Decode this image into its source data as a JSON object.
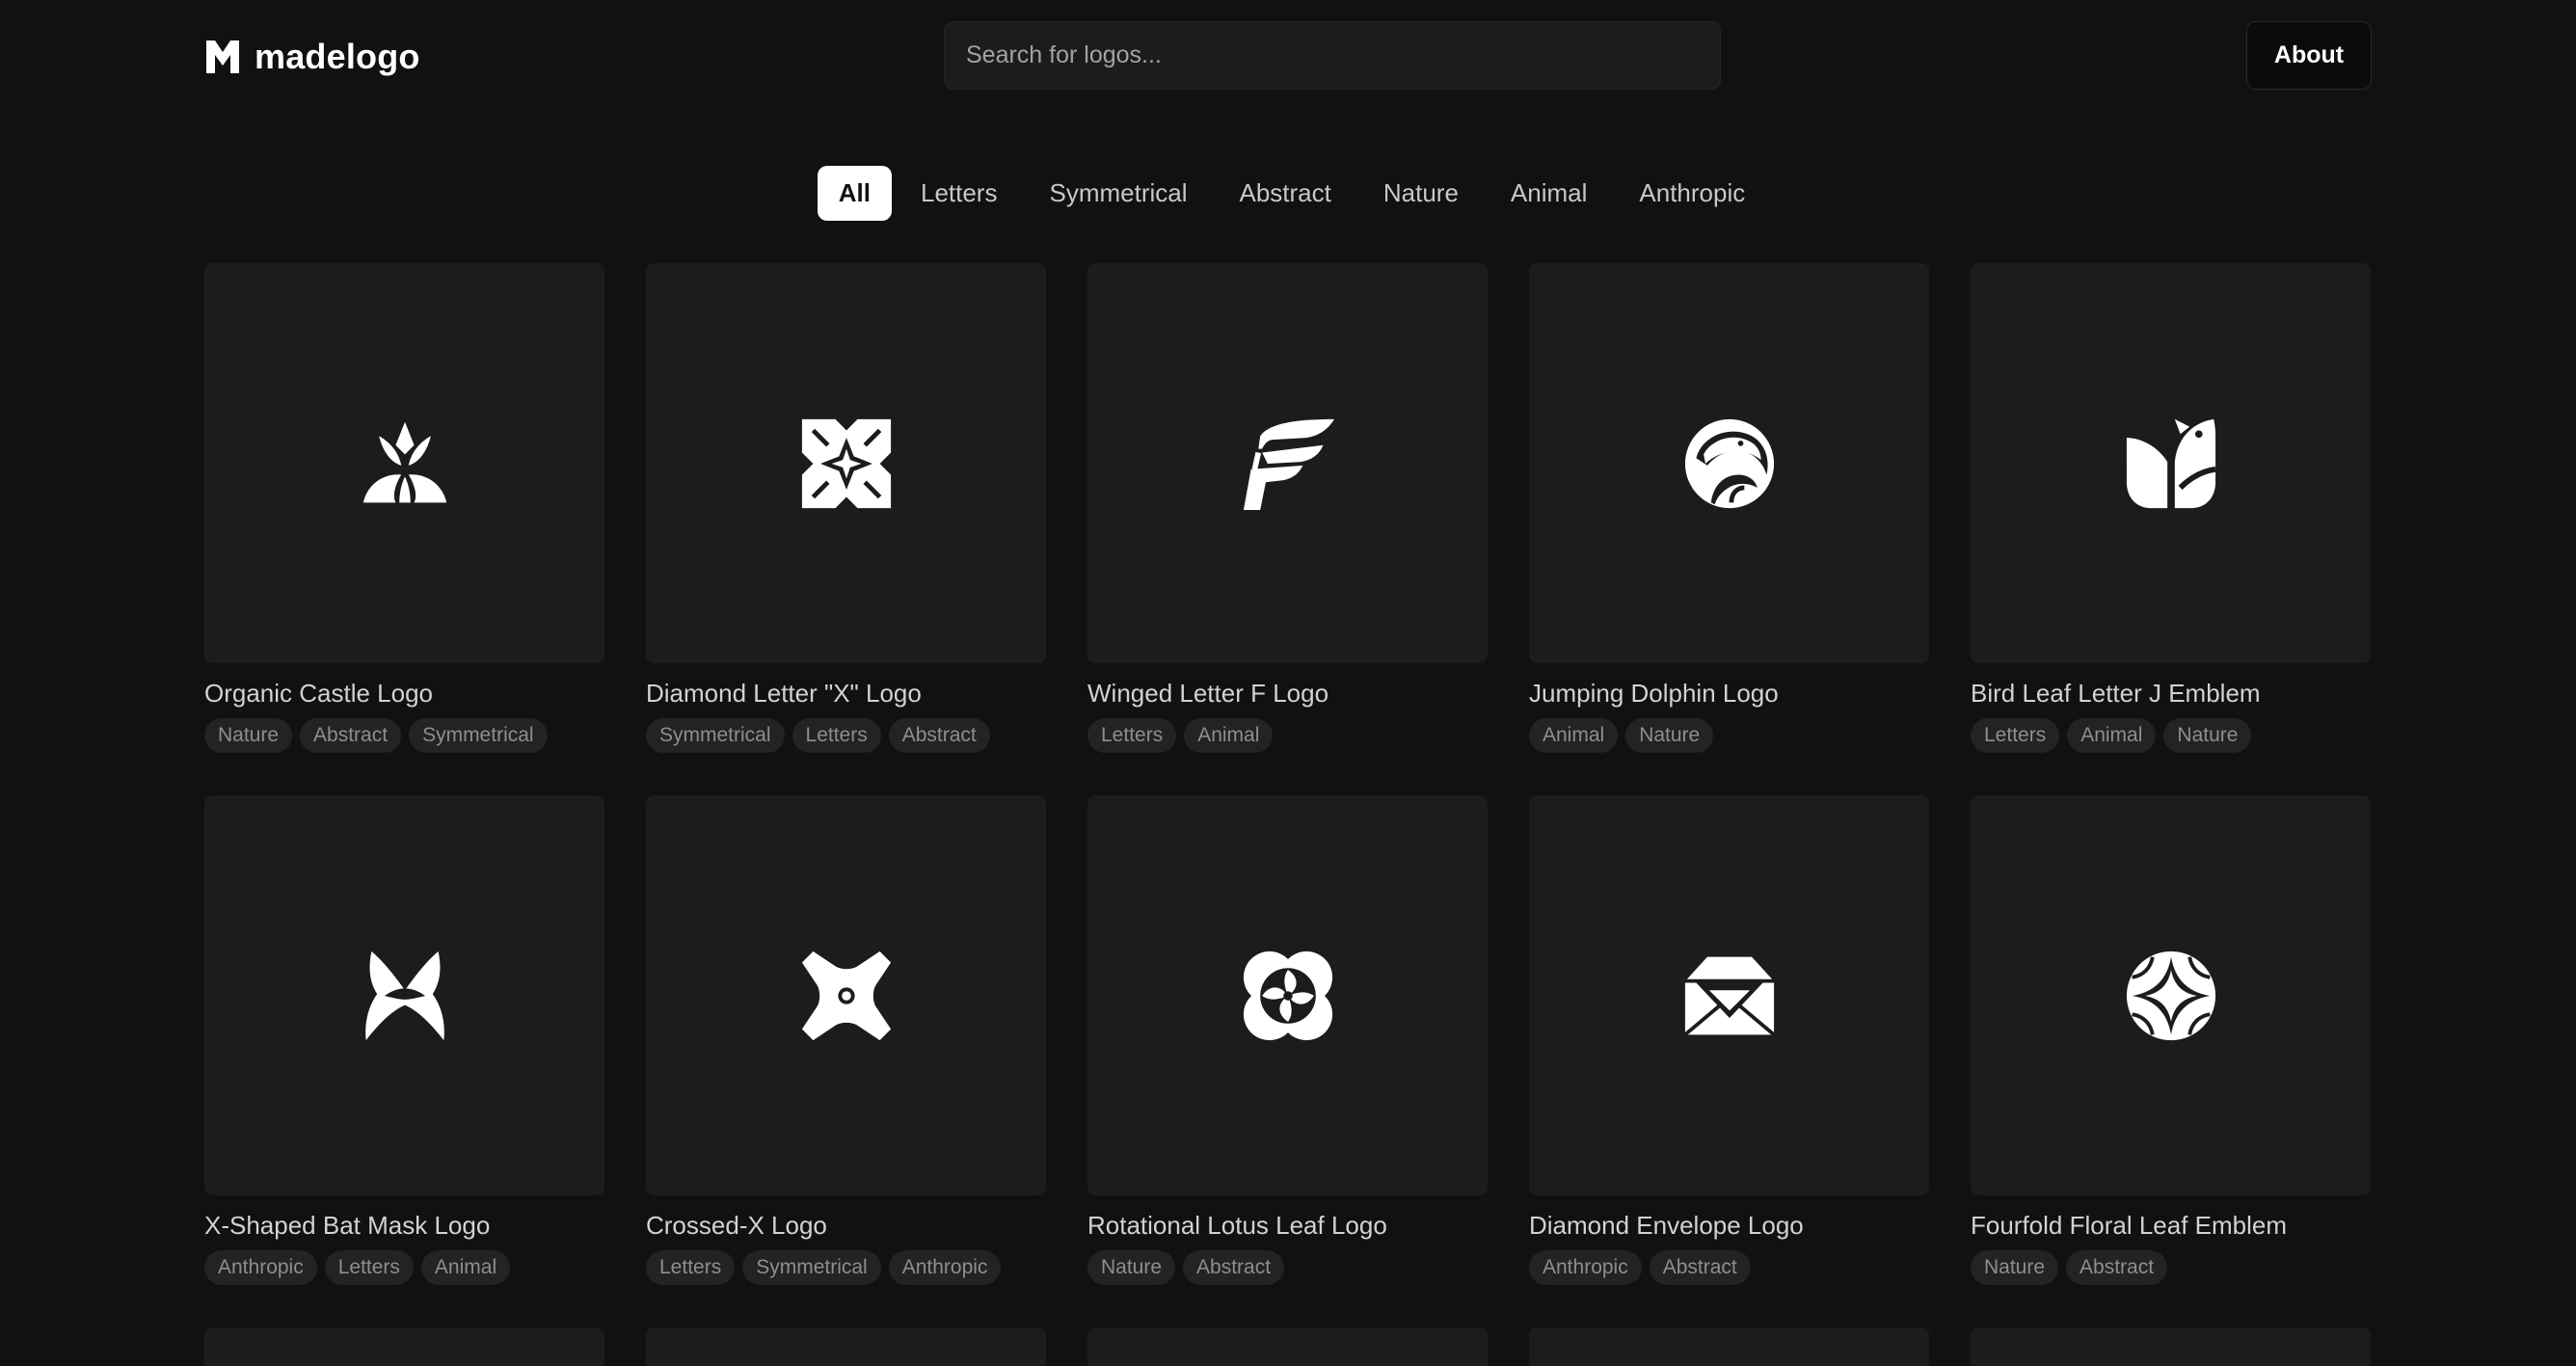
{
  "header": {
    "brand_name": "madelogo",
    "search_placeholder": "Search for logos...",
    "about_label": "About"
  },
  "filters": [
    {
      "label": "All",
      "active": true
    },
    {
      "label": "Letters",
      "active": false
    },
    {
      "label": "Symmetrical",
      "active": false
    },
    {
      "label": "Abstract",
      "active": false
    },
    {
      "label": "Nature",
      "active": false
    },
    {
      "label": "Animal",
      "active": false
    },
    {
      "label": "Anthropic",
      "active": false
    }
  ],
  "logos": [
    {
      "title": "Organic Castle Logo",
      "tags": [
        "Nature",
        "Abstract",
        "Symmetrical"
      ],
      "icon": "organic-castle-icon"
    },
    {
      "title": "Diamond Letter \"X\" Logo",
      "tags": [
        "Symmetrical",
        "Letters",
        "Abstract"
      ],
      "icon": "diamond-x-icon"
    },
    {
      "title": "Winged Letter F Logo",
      "tags": [
        "Letters",
        "Animal"
      ],
      "icon": "winged-f-icon"
    },
    {
      "title": "Jumping Dolphin Logo",
      "tags": [
        "Animal",
        "Nature"
      ],
      "icon": "dolphin-icon"
    },
    {
      "title": "Bird Leaf Letter J Emblem",
      "tags": [
        "Letters",
        "Animal",
        "Nature"
      ],
      "icon": "bird-leaf-icon"
    },
    {
      "title": "X-Shaped Bat Mask Logo",
      "tags": [
        "Anthropic",
        "Letters",
        "Animal"
      ],
      "icon": "bat-mask-icon"
    },
    {
      "title": "Crossed-X Logo",
      "tags": [
        "Letters",
        "Symmetrical",
        "Anthropic"
      ],
      "icon": "crossed-x-icon"
    },
    {
      "title": "Rotational Lotus Leaf Logo",
      "tags": [
        "Nature",
        "Abstract"
      ],
      "icon": "lotus-leaf-icon"
    },
    {
      "title": "Diamond Envelope Logo",
      "tags": [
        "Anthropic",
        "Abstract"
      ],
      "icon": "diamond-envelope-icon"
    },
    {
      "title": "Fourfold Floral Leaf Emblem",
      "tags": [
        "Nature",
        "Abstract"
      ],
      "icon": "floral-leaf-icon"
    }
  ],
  "colors": {
    "background": "#111111",
    "card": "#1c1c1c",
    "tag": "#232323",
    "accent": "#ffffff"
  }
}
